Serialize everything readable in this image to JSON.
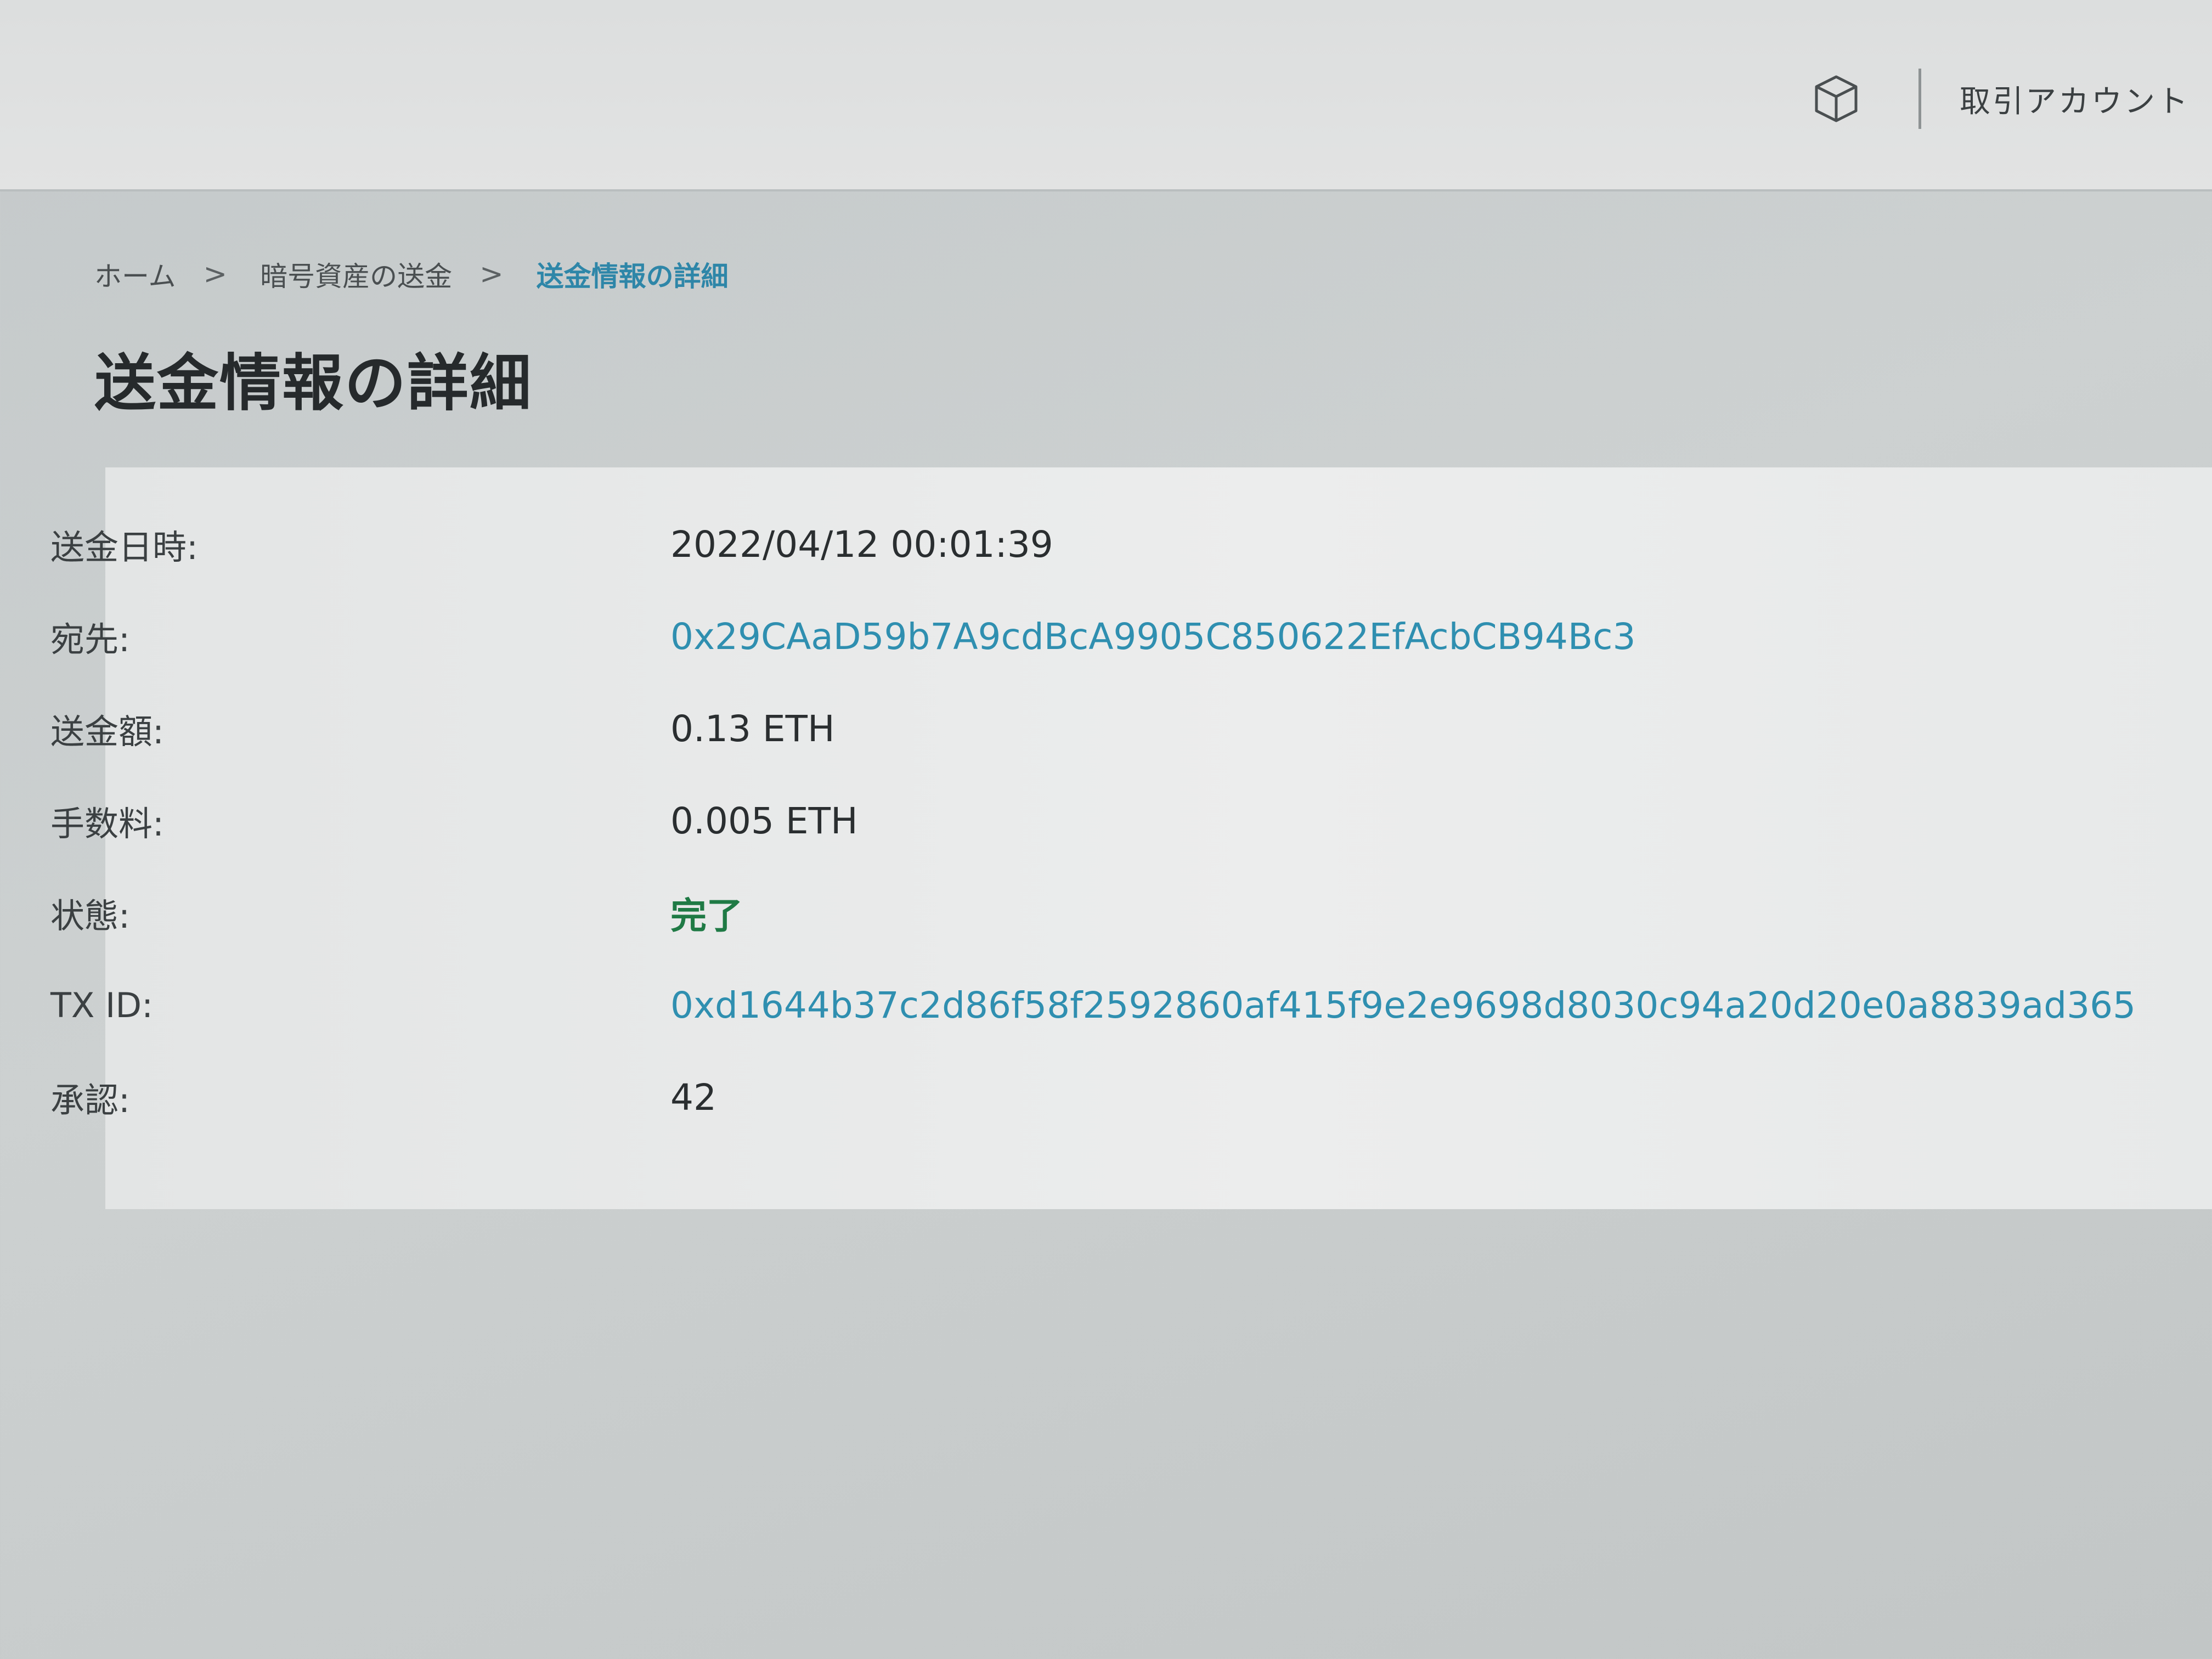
{
  "header": {
    "account_label": "取引アカウント",
    "icon": "cube-icon"
  },
  "breadcrumb": {
    "home": "ホーム",
    "separator": ">",
    "crypto_send": "暗号資産の送金",
    "current": "送金情報の詳細"
  },
  "page": {
    "title": "送金情報の詳細"
  },
  "details": [
    {
      "label": "送金日時:",
      "value": "2022/04/12 00:01:39"
    },
    {
      "label": "宛先:",
      "value": "0x29CAaD59b7A9cdBcA9905C850622EfAcbCB94Bc3"
    },
    {
      "label": "送金額:",
      "value": "0.13 ETH"
    },
    {
      "label": "手数料:",
      "value": "0.005 ETH"
    },
    {
      "label": "状態:",
      "value": "完了"
    },
    {
      "label": "TX ID:",
      "value": "0xd1644b37c2d86f58f2592860af415f9e2e9698d8030c94a20d20e0a8839ad365"
    },
    {
      "label": "承認:",
      "value": "42"
    }
  ],
  "colors": {
    "link": "#2f8fb0",
    "status_complete": "#1f7a45",
    "breadcrumb_current": "#2e86a8"
  }
}
